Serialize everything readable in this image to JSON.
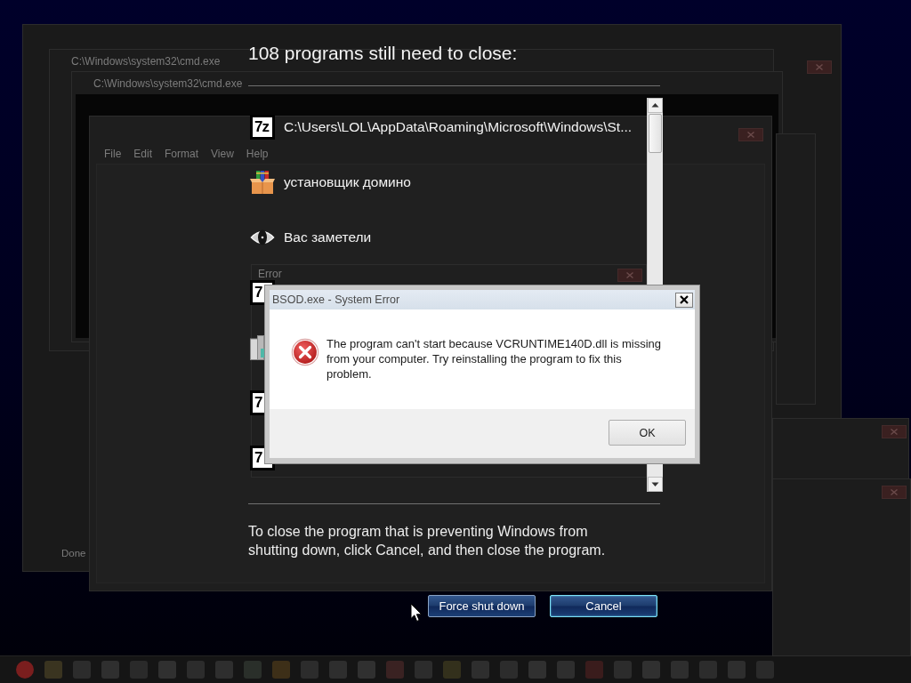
{
  "background": {
    "window_titles": [
      "C:\\Windows\\system32\\cmd.exe",
      "C:\\Windows\\system32\\cmd.exe"
    ],
    "menu": [
      "File",
      "Edit",
      "Format",
      "View",
      "Help"
    ],
    "error_title": "Error",
    "status": "Done"
  },
  "shutdown": {
    "heading": "108 programs still need to close:",
    "programs": [
      {
        "kind": "sevenzip",
        "badge": "7z",
        "name": "C:\\Users\\LOL\\AppData\\Roaming\\Microsoft\\Windows\\St..."
      },
      {
        "kind": "package",
        "name": "установщик домино"
      },
      {
        "kind": "eye",
        "name": "Вас заметели"
      },
      {
        "kind": "sevenzip",
        "badge": "7"
      },
      {
        "kind": "installer"
      },
      {
        "kind": "sevenzip",
        "badge": "7"
      },
      {
        "kind": "sevenzip",
        "badge": "7"
      }
    ],
    "message": "To close the program that is preventing Windows from shutting down, click Cancel, and then close the program.",
    "buttons": [
      {
        "label": "Force shut down",
        "focused": false
      },
      {
        "label": "Cancel",
        "focused": true
      }
    ]
  },
  "dialog": {
    "title": "BSOD.exe - System Error",
    "message": "The program can't start because VCRUNTIME140D.dll is missing from your computer. Try reinstalling the program to fix this problem.",
    "button": "OK"
  }
}
